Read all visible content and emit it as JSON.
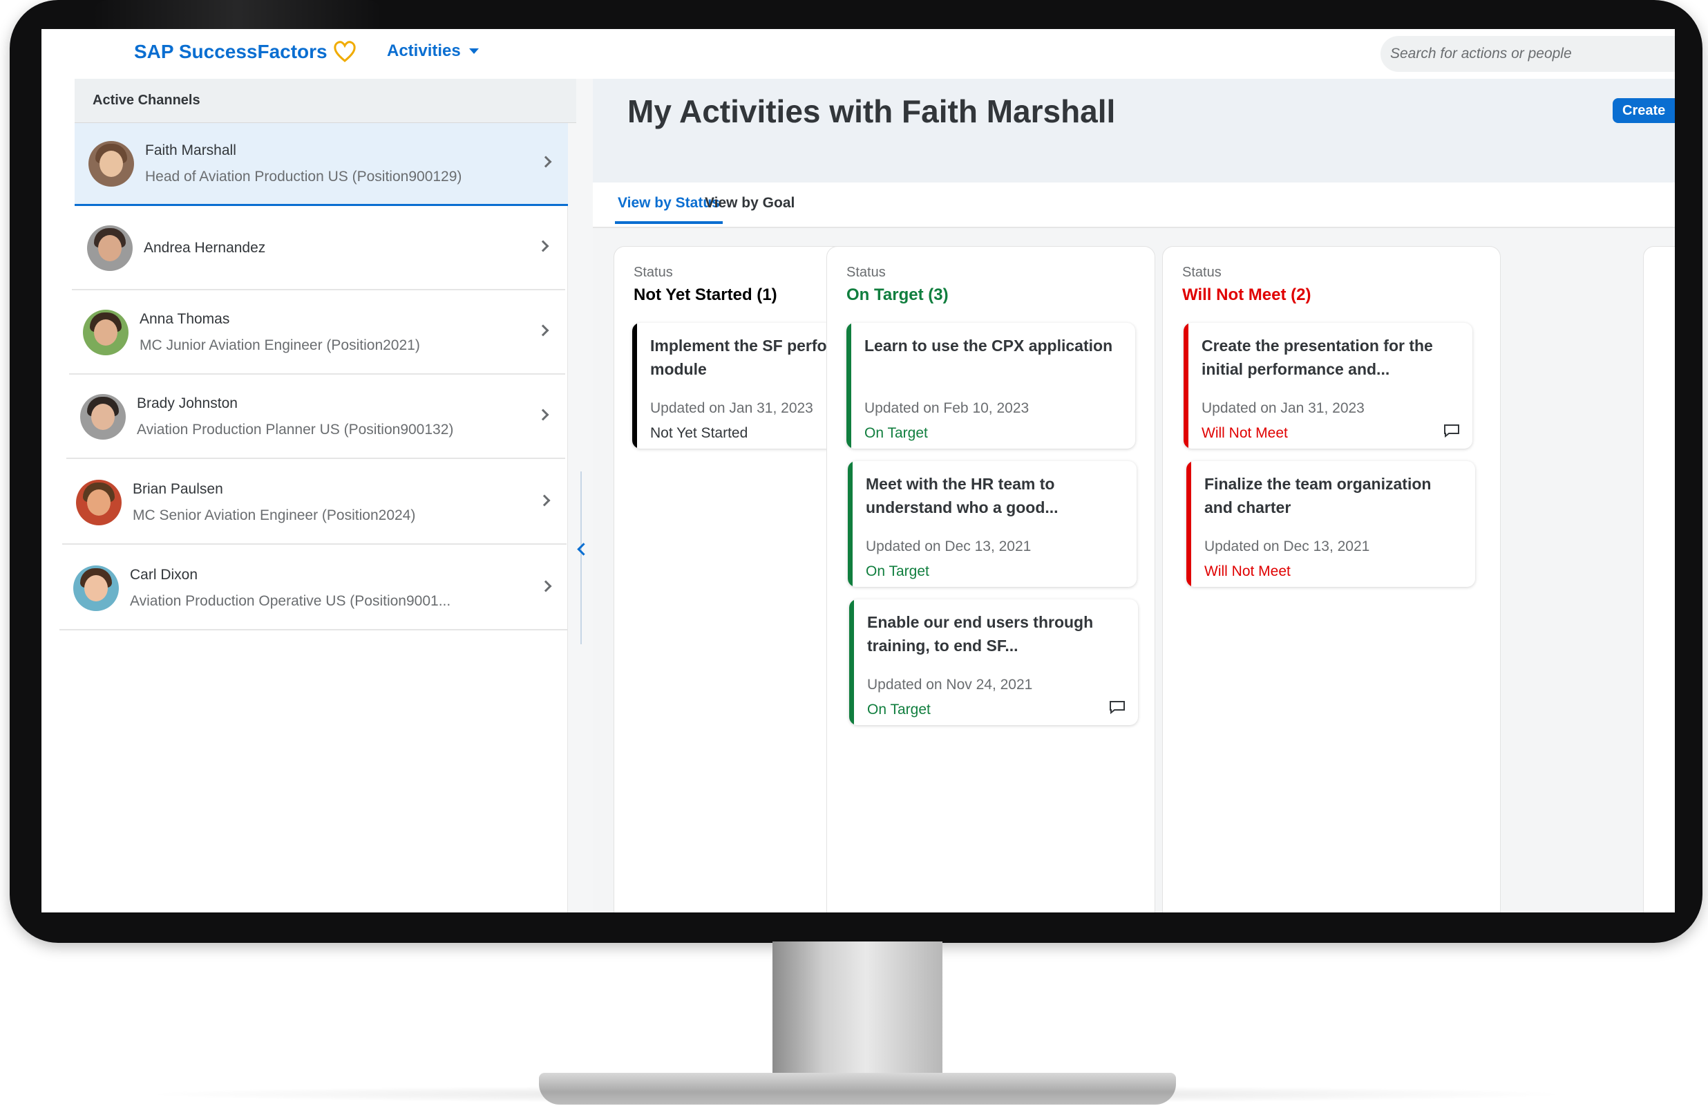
{
  "shellbar": {
    "logo_text": "SAP SuccessFactors",
    "menu_label": "Activities",
    "search_placeholder": "Search for actions or people"
  },
  "sidebar": {
    "header": "Active Channels",
    "items": [
      {
        "name": "Faith Marshall",
        "subtitle": "Head of Aviation Production US (Position900129)",
        "selected": true
      },
      {
        "name": "Andrea Hernandez",
        "subtitle": ""
      },
      {
        "name": "Anna Thomas",
        "subtitle": "MC Junior Aviation Engineer (Position2021)"
      },
      {
        "name": "Brady Johnston",
        "subtitle": "Aviation Production Planner US (Position900132)"
      },
      {
        "name": "Brian Paulsen",
        "subtitle": "MC Senior Aviation Engineer (Position2024)"
      },
      {
        "name": "Carl Dixon",
        "subtitle": "Aviation Production Operative US (Position9001..."
      }
    ]
  },
  "main": {
    "title": "My Activities with Faith Marshall",
    "create_label": "Create",
    "tabs": [
      {
        "label": "View by Status",
        "active": true
      },
      {
        "label": "View by Goal",
        "active": false
      }
    ],
    "columns": [
      {
        "label": "Status",
        "title": "Not Yet Started (1)",
        "color": "#000000",
        "cards": [
          {
            "title": "Implement the SF performance module",
            "updated": "Updated on Jan 31, 2023",
            "status": "Not Yet Started",
            "comment": false
          }
        ]
      },
      {
        "label": "Status",
        "title": "On Target (3)",
        "color": "#107e3e",
        "cards": [
          {
            "title": "Learn to use the CPX application",
            "updated": "Updated on Feb 10, 2023",
            "status": "On Target",
            "comment": false
          },
          {
            "title": "Meet with the HR team to understand who a good...",
            "updated": "Updated on Dec 13, 2021",
            "status": "On Target",
            "comment": false
          },
          {
            "title": "Enable our end users through training, to end SF...",
            "updated": "Updated on Nov 24, 2021",
            "status": "On Target",
            "comment": true
          }
        ]
      },
      {
        "label": "Status",
        "title": "Will Not Meet (2)",
        "color": "#e00000",
        "cards": [
          {
            "title": "Create the presentation for the initial performance and...",
            "updated": "Updated on Jan 31, 2023",
            "status": "Will Not Meet",
            "comment": true
          },
          {
            "title": "Finalize the team organization and charter",
            "updated": "Updated on Dec 13, 2021",
            "status": "Will Not Meet",
            "comment": false
          }
        ]
      }
    ]
  },
  "colors": {
    "accent": "#0a6ed1",
    "on_target": "#107e3e",
    "will_not_meet": "#e00000",
    "not_started": "#000000"
  }
}
